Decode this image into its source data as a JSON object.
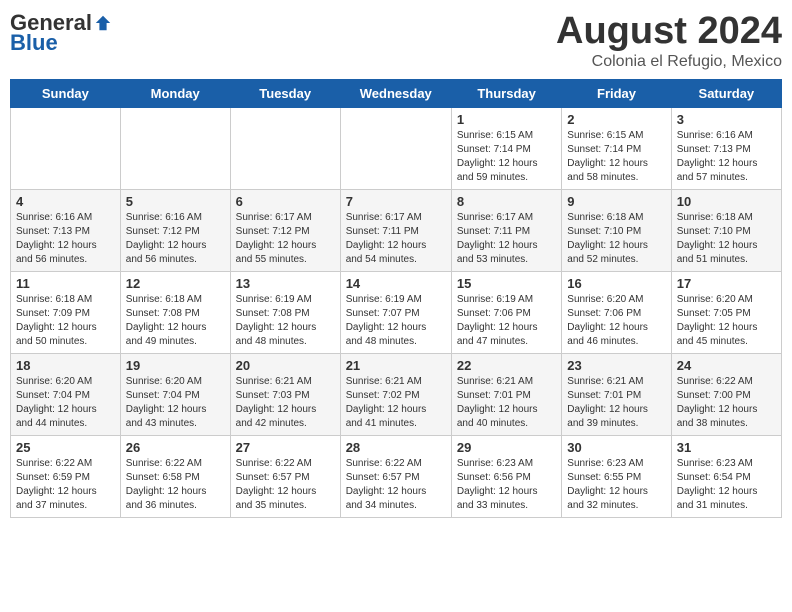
{
  "logo": {
    "general": "General",
    "blue": "Blue"
  },
  "title": {
    "month_year": "August 2024",
    "location": "Colonia el Refugio, Mexico"
  },
  "days_of_week": [
    "Sunday",
    "Monday",
    "Tuesday",
    "Wednesday",
    "Thursday",
    "Friday",
    "Saturday"
  ],
  "weeks": [
    [
      {
        "day": "",
        "info": ""
      },
      {
        "day": "",
        "info": ""
      },
      {
        "day": "",
        "info": ""
      },
      {
        "day": "",
        "info": ""
      },
      {
        "day": "1",
        "info": "Sunrise: 6:15 AM\nSunset: 7:14 PM\nDaylight: 12 hours\nand 59 minutes."
      },
      {
        "day": "2",
        "info": "Sunrise: 6:15 AM\nSunset: 7:14 PM\nDaylight: 12 hours\nand 58 minutes."
      },
      {
        "day": "3",
        "info": "Sunrise: 6:16 AM\nSunset: 7:13 PM\nDaylight: 12 hours\nand 57 minutes."
      }
    ],
    [
      {
        "day": "4",
        "info": "Sunrise: 6:16 AM\nSunset: 7:13 PM\nDaylight: 12 hours\nand 56 minutes."
      },
      {
        "day": "5",
        "info": "Sunrise: 6:16 AM\nSunset: 7:12 PM\nDaylight: 12 hours\nand 56 minutes."
      },
      {
        "day": "6",
        "info": "Sunrise: 6:17 AM\nSunset: 7:12 PM\nDaylight: 12 hours\nand 55 minutes."
      },
      {
        "day": "7",
        "info": "Sunrise: 6:17 AM\nSunset: 7:11 PM\nDaylight: 12 hours\nand 54 minutes."
      },
      {
        "day": "8",
        "info": "Sunrise: 6:17 AM\nSunset: 7:11 PM\nDaylight: 12 hours\nand 53 minutes."
      },
      {
        "day": "9",
        "info": "Sunrise: 6:18 AM\nSunset: 7:10 PM\nDaylight: 12 hours\nand 52 minutes."
      },
      {
        "day": "10",
        "info": "Sunrise: 6:18 AM\nSunset: 7:10 PM\nDaylight: 12 hours\nand 51 minutes."
      }
    ],
    [
      {
        "day": "11",
        "info": "Sunrise: 6:18 AM\nSunset: 7:09 PM\nDaylight: 12 hours\nand 50 minutes."
      },
      {
        "day": "12",
        "info": "Sunrise: 6:18 AM\nSunset: 7:08 PM\nDaylight: 12 hours\nand 49 minutes."
      },
      {
        "day": "13",
        "info": "Sunrise: 6:19 AM\nSunset: 7:08 PM\nDaylight: 12 hours\nand 48 minutes."
      },
      {
        "day": "14",
        "info": "Sunrise: 6:19 AM\nSunset: 7:07 PM\nDaylight: 12 hours\nand 48 minutes."
      },
      {
        "day": "15",
        "info": "Sunrise: 6:19 AM\nSunset: 7:06 PM\nDaylight: 12 hours\nand 47 minutes."
      },
      {
        "day": "16",
        "info": "Sunrise: 6:20 AM\nSunset: 7:06 PM\nDaylight: 12 hours\nand 46 minutes."
      },
      {
        "day": "17",
        "info": "Sunrise: 6:20 AM\nSunset: 7:05 PM\nDaylight: 12 hours\nand 45 minutes."
      }
    ],
    [
      {
        "day": "18",
        "info": "Sunrise: 6:20 AM\nSunset: 7:04 PM\nDaylight: 12 hours\nand 44 minutes."
      },
      {
        "day": "19",
        "info": "Sunrise: 6:20 AM\nSunset: 7:04 PM\nDaylight: 12 hours\nand 43 minutes."
      },
      {
        "day": "20",
        "info": "Sunrise: 6:21 AM\nSunset: 7:03 PM\nDaylight: 12 hours\nand 42 minutes."
      },
      {
        "day": "21",
        "info": "Sunrise: 6:21 AM\nSunset: 7:02 PM\nDaylight: 12 hours\nand 41 minutes."
      },
      {
        "day": "22",
        "info": "Sunrise: 6:21 AM\nSunset: 7:01 PM\nDaylight: 12 hours\nand 40 minutes."
      },
      {
        "day": "23",
        "info": "Sunrise: 6:21 AM\nSunset: 7:01 PM\nDaylight: 12 hours\nand 39 minutes."
      },
      {
        "day": "24",
        "info": "Sunrise: 6:22 AM\nSunset: 7:00 PM\nDaylight: 12 hours\nand 38 minutes."
      }
    ],
    [
      {
        "day": "25",
        "info": "Sunrise: 6:22 AM\nSunset: 6:59 PM\nDaylight: 12 hours\nand 37 minutes."
      },
      {
        "day": "26",
        "info": "Sunrise: 6:22 AM\nSunset: 6:58 PM\nDaylight: 12 hours\nand 36 minutes."
      },
      {
        "day": "27",
        "info": "Sunrise: 6:22 AM\nSunset: 6:57 PM\nDaylight: 12 hours\nand 35 minutes."
      },
      {
        "day": "28",
        "info": "Sunrise: 6:22 AM\nSunset: 6:57 PM\nDaylight: 12 hours\nand 34 minutes."
      },
      {
        "day": "29",
        "info": "Sunrise: 6:23 AM\nSunset: 6:56 PM\nDaylight: 12 hours\nand 33 minutes."
      },
      {
        "day": "30",
        "info": "Sunrise: 6:23 AM\nSunset: 6:55 PM\nDaylight: 12 hours\nand 32 minutes."
      },
      {
        "day": "31",
        "info": "Sunrise: 6:23 AM\nSunset: 6:54 PM\nDaylight: 12 hours\nand 31 minutes."
      }
    ]
  ]
}
